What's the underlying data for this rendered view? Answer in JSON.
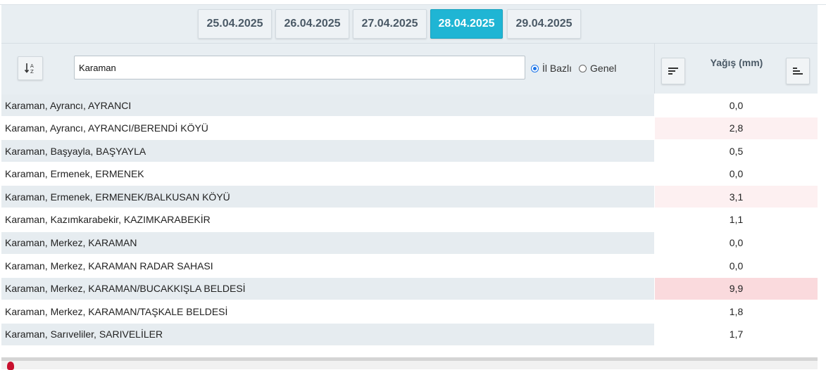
{
  "dates": [
    {
      "label": "25.04.2025",
      "active": false
    },
    {
      "label": "26.04.2025",
      "active": false
    },
    {
      "label": "27.04.2025",
      "active": false
    },
    {
      "label": "28.04.2025",
      "active": true
    },
    {
      "label": "29.04.2025",
      "active": false
    }
  ],
  "filter": {
    "search_value": "Karaman",
    "sort_icon": "sort-alpha-icon",
    "radio_options": [
      {
        "label": "İl Bazlı",
        "checked": true
      },
      {
        "label": "Genel",
        "checked": false
      }
    ]
  },
  "column": {
    "title": "Yağış (mm)",
    "sort_desc_icon": "sort-descending-icon",
    "sort_asc_icon": "sort-ascending-icon"
  },
  "colors": {
    "accent": "#1fb5d4",
    "header_bg": "#e8eef2",
    "stripe": "#e6ecf0",
    "light_red": "#fdf0f1",
    "red": "#fadadd"
  },
  "rows": [
    {
      "name": "Karaman, Ayrancı, AYRANCI",
      "value": "0,0",
      "highlight": "none"
    },
    {
      "name": "Karaman, Ayrancı, AYRANCI/BERENDİ KÖYÜ",
      "value": "2,8",
      "highlight": "light"
    },
    {
      "name": "Karaman, Başyayla, BAŞYAYLA",
      "value": "0,5",
      "highlight": "none"
    },
    {
      "name": "Karaman, Ermenek, ERMENEK",
      "value": "0,0",
      "highlight": "none"
    },
    {
      "name": "Karaman, Ermenek, ERMENEK/BALKUSAN KÖYÜ",
      "value": "3,1",
      "highlight": "light"
    },
    {
      "name": "Karaman, Kazımkarabekir, KAZIMKARABEKİR",
      "value": "1,1",
      "highlight": "none"
    },
    {
      "name": "Karaman, Merkez, KARAMAN",
      "value": "0,0",
      "highlight": "none"
    },
    {
      "name": "Karaman, Merkez, KARAMAN RADAR SAHASI",
      "value": "0,0",
      "highlight": "none"
    },
    {
      "name": "Karaman, Merkez, KARAMAN/BUCAKKIŞLA BELDESİ",
      "value": "9,9",
      "highlight": "strong"
    },
    {
      "name": "Karaman, Merkez, KARAMAN/TAŞKALE BELDESİ",
      "value": "1,8",
      "highlight": "none"
    },
    {
      "name": "Karaman, Sarıveliler, SARIVELİLER",
      "value": "1,7",
      "highlight": "none"
    }
  ]
}
